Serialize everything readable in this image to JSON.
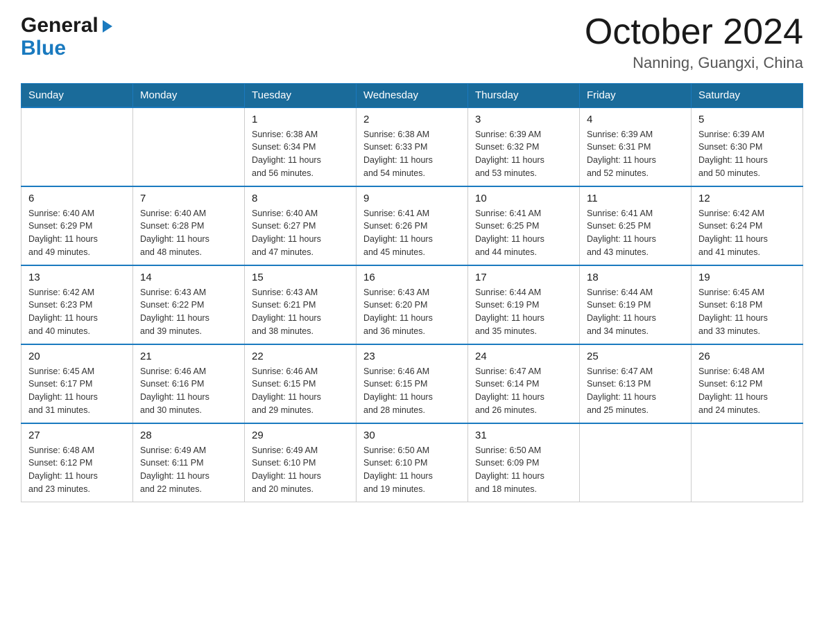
{
  "logo": {
    "general": "General",
    "blue": "Blue",
    "arrow_unicode": "▶"
  },
  "title": "October 2024",
  "location": "Nanning, Guangxi, China",
  "days_header": [
    "Sunday",
    "Monday",
    "Tuesday",
    "Wednesday",
    "Thursday",
    "Friday",
    "Saturday"
  ],
  "weeks": [
    [
      {
        "day": "",
        "info": ""
      },
      {
        "day": "",
        "info": ""
      },
      {
        "day": "1",
        "info": "Sunrise: 6:38 AM\nSunset: 6:34 PM\nDaylight: 11 hours\nand 56 minutes."
      },
      {
        "day": "2",
        "info": "Sunrise: 6:38 AM\nSunset: 6:33 PM\nDaylight: 11 hours\nand 54 minutes."
      },
      {
        "day": "3",
        "info": "Sunrise: 6:39 AM\nSunset: 6:32 PM\nDaylight: 11 hours\nand 53 minutes."
      },
      {
        "day": "4",
        "info": "Sunrise: 6:39 AM\nSunset: 6:31 PM\nDaylight: 11 hours\nand 52 minutes."
      },
      {
        "day": "5",
        "info": "Sunrise: 6:39 AM\nSunset: 6:30 PM\nDaylight: 11 hours\nand 50 minutes."
      }
    ],
    [
      {
        "day": "6",
        "info": "Sunrise: 6:40 AM\nSunset: 6:29 PM\nDaylight: 11 hours\nand 49 minutes."
      },
      {
        "day": "7",
        "info": "Sunrise: 6:40 AM\nSunset: 6:28 PM\nDaylight: 11 hours\nand 48 minutes."
      },
      {
        "day": "8",
        "info": "Sunrise: 6:40 AM\nSunset: 6:27 PM\nDaylight: 11 hours\nand 47 minutes."
      },
      {
        "day": "9",
        "info": "Sunrise: 6:41 AM\nSunset: 6:26 PM\nDaylight: 11 hours\nand 45 minutes."
      },
      {
        "day": "10",
        "info": "Sunrise: 6:41 AM\nSunset: 6:25 PM\nDaylight: 11 hours\nand 44 minutes."
      },
      {
        "day": "11",
        "info": "Sunrise: 6:41 AM\nSunset: 6:25 PM\nDaylight: 11 hours\nand 43 minutes."
      },
      {
        "day": "12",
        "info": "Sunrise: 6:42 AM\nSunset: 6:24 PM\nDaylight: 11 hours\nand 41 minutes."
      }
    ],
    [
      {
        "day": "13",
        "info": "Sunrise: 6:42 AM\nSunset: 6:23 PM\nDaylight: 11 hours\nand 40 minutes."
      },
      {
        "day": "14",
        "info": "Sunrise: 6:43 AM\nSunset: 6:22 PM\nDaylight: 11 hours\nand 39 minutes."
      },
      {
        "day": "15",
        "info": "Sunrise: 6:43 AM\nSunset: 6:21 PM\nDaylight: 11 hours\nand 38 minutes."
      },
      {
        "day": "16",
        "info": "Sunrise: 6:43 AM\nSunset: 6:20 PM\nDaylight: 11 hours\nand 36 minutes."
      },
      {
        "day": "17",
        "info": "Sunrise: 6:44 AM\nSunset: 6:19 PM\nDaylight: 11 hours\nand 35 minutes."
      },
      {
        "day": "18",
        "info": "Sunrise: 6:44 AM\nSunset: 6:19 PM\nDaylight: 11 hours\nand 34 minutes."
      },
      {
        "day": "19",
        "info": "Sunrise: 6:45 AM\nSunset: 6:18 PM\nDaylight: 11 hours\nand 33 minutes."
      }
    ],
    [
      {
        "day": "20",
        "info": "Sunrise: 6:45 AM\nSunset: 6:17 PM\nDaylight: 11 hours\nand 31 minutes."
      },
      {
        "day": "21",
        "info": "Sunrise: 6:46 AM\nSunset: 6:16 PM\nDaylight: 11 hours\nand 30 minutes."
      },
      {
        "day": "22",
        "info": "Sunrise: 6:46 AM\nSunset: 6:15 PM\nDaylight: 11 hours\nand 29 minutes."
      },
      {
        "day": "23",
        "info": "Sunrise: 6:46 AM\nSunset: 6:15 PM\nDaylight: 11 hours\nand 28 minutes."
      },
      {
        "day": "24",
        "info": "Sunrise: 6:47 AM\nSunset: 6:14 PM\nDaylight: 11 hours\nand 26 minutes."
      },
      {
        "day": "25",
        "info": "Sunrise: 6:47 AM\nSunset: 6:13 PM\nDaylight: 11 hours\nand 25 minutes."
      },
      {
        "day": "26",
        "info": "Sunrise: 6:48 AM\nSunset: 6:12 PM\nDaylight: 11 hours\nand 24 minutes."
      }
    ],
    [
      {
        "day": "27",
        "info": "Sunrise: 6:48 AM\nSunset: 6:12 PM\nDaylight: 11 hours\nand 23 minutes."
      },
      {
        "day": "28",
        "info": "Sunrise: 6:49 AM\nSunset: 6:11 PM\nDaylight: 11 hours\nand 22 minutes."
      },
      {
        "day": "29",
        "info": "Sunrise: 6:49 AM\nSunset: 6:10 PM\nDaylight: 11 hours\nand 20 minutes."
      },
      {
        "day": "30",
        "info": "Sunrise: 6:50 AM\nSunset: 6:10 PM\nDaylight: 11 hours\nand 19 minutes."
      },
      {
        "day": "31",
        "info": "Sunrise: 6:50 AM\nSunset: 6:09 PM\nDaylight: 11 hours\nand 18 minutes."
      },
      {
        "day": "",
        "info": ""
      },
      {
        "day": "",
        "info": ""
      }
    ]
  ]
}
